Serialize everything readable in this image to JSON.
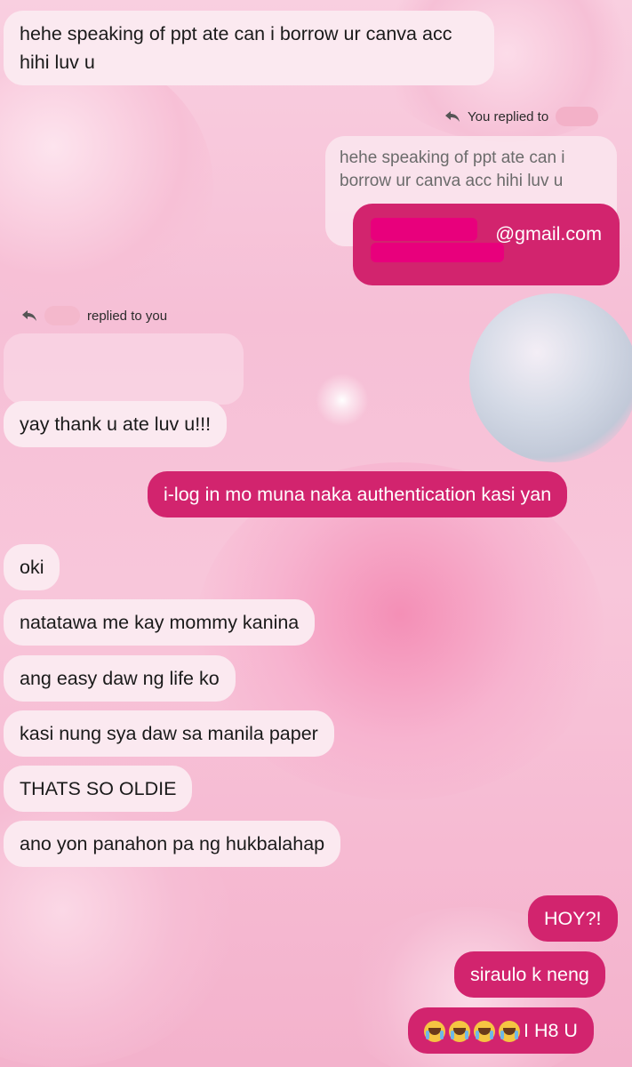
{
  "messages": {
    "m1": "hehe speaking of ppt ate can i borrow ur canva acc hihi luv u",
    "reply_meta_1": "You replied to",
    "quoted_1": "hehe speaking of ppt ate can i borrow ur canva acc hihi luv u",
    "email_suffix": "@gmail.com",
    "reply_meta_2": "replied to you",
    "m2": "yay thank u ate luv u!!!",
    "m3": "i-log in mo muna naka authentication kasi yan",
    "m4": "oki",
    "m5": "natatawa me kay mommy kanina",
    "m6": "ang easy daw ng life ko",
    "m7": "kasi nung sya daw sa manila paper",
    "m8": "THATS SO OLDIE",
    "m9": "ano yon panahon pa ng hukbalahap",
    "m10": "HOY?!",
    "m11": "siraulo k neng",
    "m12_text": "I H8 U"
  },
  "icons": {
    "reply": "reply-arrow-icon",
    "crying": "loudly-crying-face-emoji"
  },
  "colors": {
    "outgoing_bubble": "#d2246e",
    "incoming_bubble": "#fbe9f0",
    "redaction": "#e8007c"
  }
}
